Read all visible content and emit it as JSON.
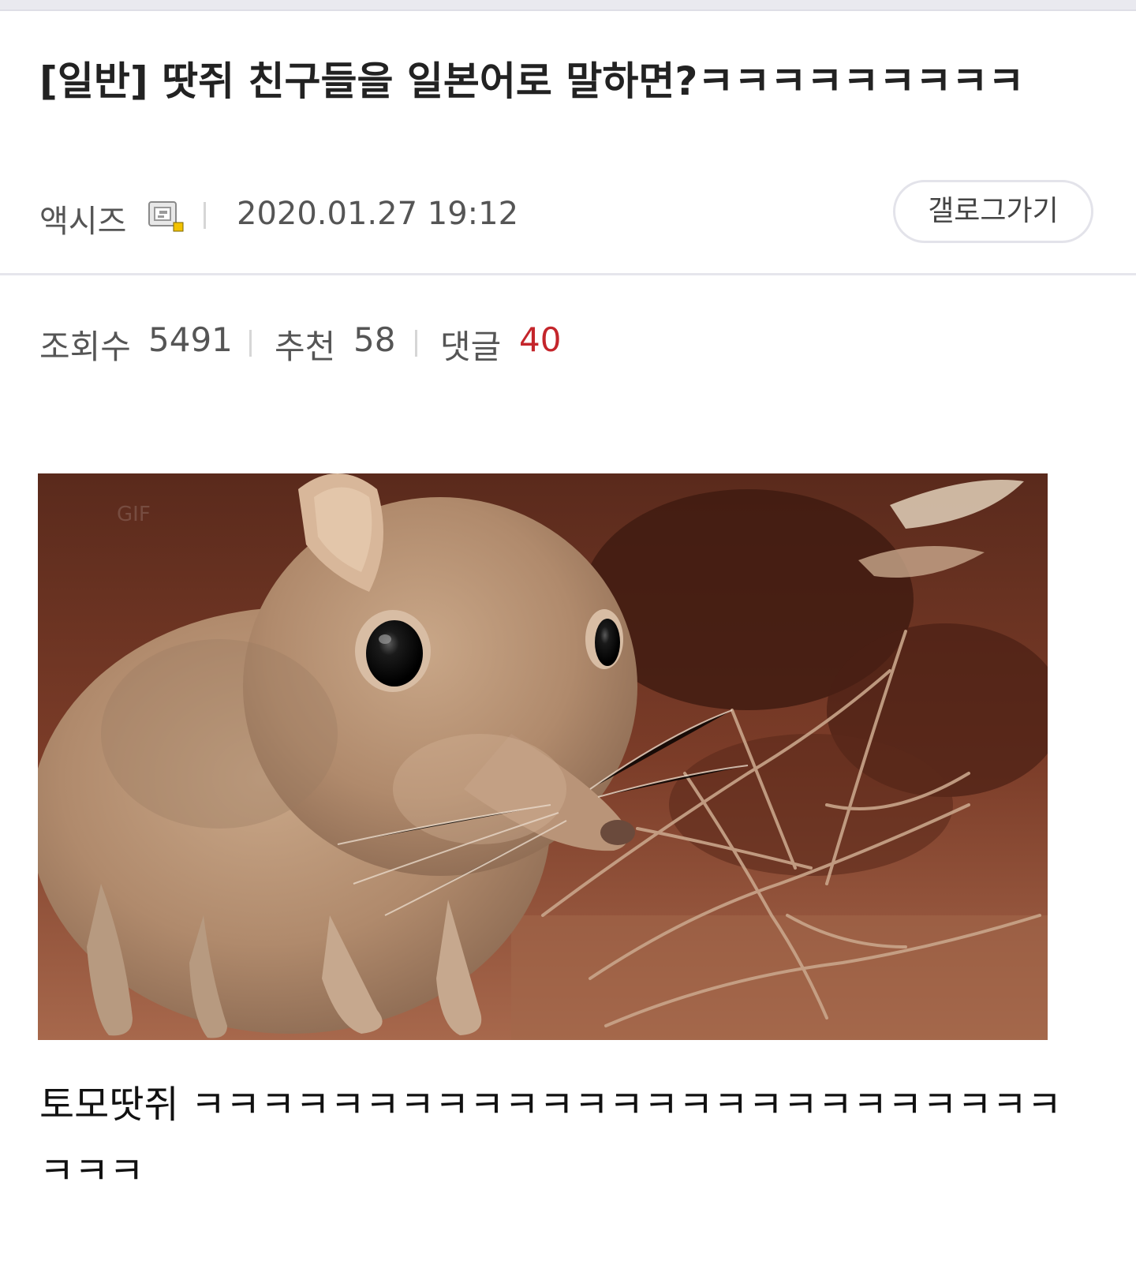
{
  "post": {
    "title": "[일반] 땃쥐 친구들을 일본어로 말하면?ㅋㅋㅋㅋㅋㅋㅋㅋㅋ",
    "author": "액시즈",
    "author_icon": "member-badge-icon",
    "date": "2020.01.27 19:12",
    "gallery_button": "갤로그가기"
  },
  "stats": {
    "views_label": "조회수",
    "views": "5491",
    "recommend_label": "추천",
    "recommend": "58",
    "comments_label": "댓글",
    "comments": "40"
  },
  "content": {
    "image_subject": "elephant-shrew-photo",
    "text": "토모땃쥐 ㅋㅋㅋㅋㅋㅋㅋㅋㅋㅋㅋㅋㅋㅋㅋㅋㅋㅋㅋㅋㅋㅋㅋㅋㅋㅋㅋㅋ"
  },
  "colors": {
    "accent_red": "#c4252b",
    "text_gray": "#555555",
    "divider": "#e6e6ec"
  }
}
